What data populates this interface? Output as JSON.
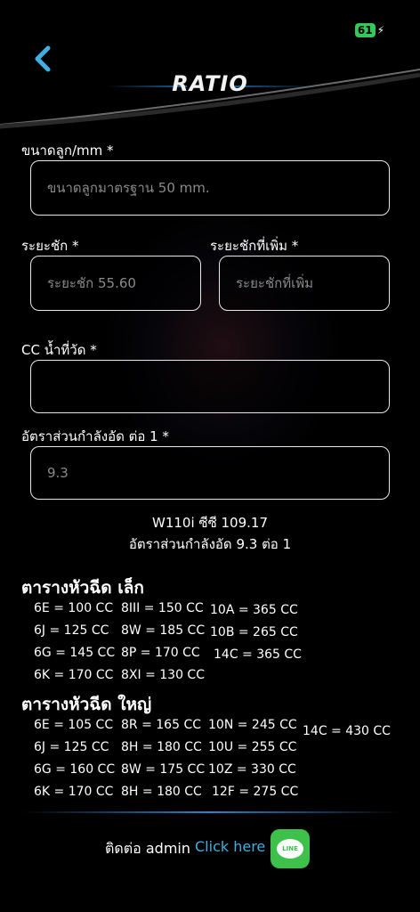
{
  "status": {
    "battery": "61"
  },
  "header": {
    "title": "RATIO"
  },
  "form": {
    "ball_size_label": "ขนาดลูก/mm *",
    "ball_size_placeholder": "ขนาดลูกมาตรฐาน 50 mm.",
    "stroke_label": "ระยะชัก *",
    "stroke_placeholder": "ระยะชัก 55.60",
    "extra_stroke_label": "ระยะชักที่เพิ่ม *",
    "extra_stroke_placeholder": "ระยะชักที่เพิ่ม",
    "cc_label": "CC น้ำที่วัด *",
    "cc_value": "",
    "ratio_label": "อัตราส่วนกำลังอัด ต่อ 1 *",
    "ratio_placeholder": "9.3"
  },
  "result": {
    "line1": "W110i  ซีซี  109.17",
    "line2": "อัตราส่วนกำลังอัด 9.3 ต่อ 1"
  },
  "small_nozzle": {
    "title": "ตารางหัวฉีด เล็ก",
    "col1": [
      "6E = 100 CC",
      "6J = 125 CC",
      "6G = 145 CC",
      "6K = 170 CC"
    ],
    "col2": [
      "8III = 150 CC",
      "8W = 185 CC",
      "8P = 170 CC",
      "8XI = 130 CC"
    ],
    "col3": [
      "10A = 365 CC",
      "10B = 265 CC",
      "14C = 365 CC"
    ]
  },
  "large_nozzle": {
    "title": "ตารางหัวฉีด ใหญ่",
    "col1": [
      "6E = 105 CC",
      "6J = 125 CC",
      "6G = 160 CC",
      "6K = 170 CC"
    ],
    "col2": [
      "8R = 165 CC",
      "8H = 180 CC",
      "8W = 175 CC",
      "8H = 180 CC"
    ],
    "col3": [
      "10N = 245 CC",
      "10U = 255 CC",
      "10Z = 330 CC",
      "12F = 275 CC"
    ],
    "col4": [
      "14C = 430 CC"
    ]
  },
  "footer": {
    "contact": "ติดต่อ admin",
    "click_here": "Click here",
    "line_icon_text": "LINE"
  },
  "colors": {
    "accent": "#3fb0e0",
    "line_green": "#3ec14a",
    "battery_green": "#34c759"
  }
}
